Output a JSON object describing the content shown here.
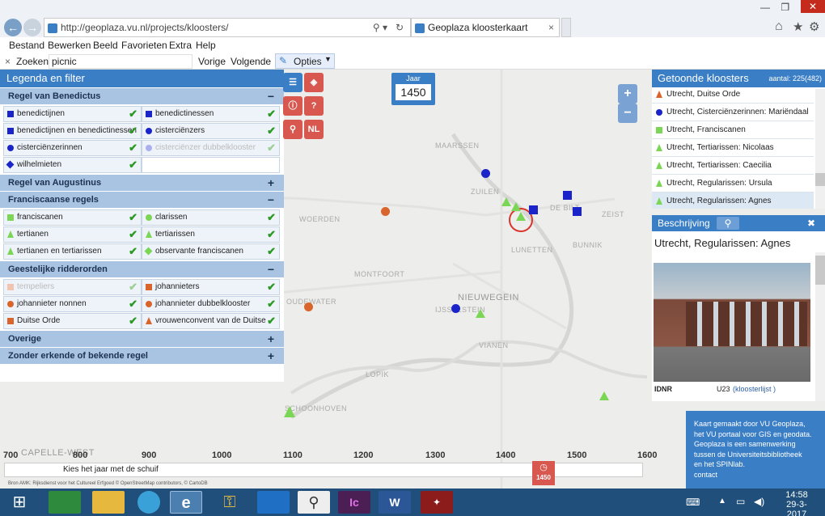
{
  "browser": {
    "url": "http://geoplaza.vu.nl/projects/kloosters/",
    "tab_title": "Geoplaza kloosterkaart",
    "tab_close": "×"
  },
  "menu": [
    "Bestand",
    "Bewerken",
    "Beeld",
    "Favorieten",
    "Extra",
    "Help"
  ],
  "find": {
    "close": "×",
    "label": "Zoeken:",
    "value": "picnic",
    "prev": "Vorige",
    "next": "Volgende",
    "options": "Opties"
  },
  "legend": {
    "title": "Legenda en filter",
    "sections": [
      {
        "title": "Regel van Benedictus",
        "sign": "−",
        "items": [
          {
            "label": "benedictijnen",
            "shape": "sq",
            "color": "#1a24c8",
            "faded": false
          },
          {
            "label": "benedictinessen",
            "shape": "sq",
            "color": "#1a24c8",
            "faded": false
          },
          {
            "label": "benedictijnen en benedictinessen",
            "shape": "sq",
            "color": "#1a24c8",
            "faded": false
          },
          {
            "label": "cisterciënzers",
            "shape": "ci",
            "color": "#1a24c8",
            "faded": false
          },
          {
            "label": "cisterciënzerinnen",
            "shape": "ci",
            "color": "#1a24c8",
            "faded": false
          },
          {
            "label": "cisterciënzer dubbelklooster",
            "shape": "ci",
            "color": "#aab0ee",
            "faded": true
          },
          {
            "label": "wilhelmieten",
            "shape": "di",
            "color": "#1a24c8",
            "faded": false
          }
        ]
      },
      {
        "title": "Regel van Augustinus",
        "sign": "+",
        "items": []
      },
      {
        "title": "Franciscaanse regels",
        "sign": "−",
        "items": [
          {
            "label": "franciscanen",
            "shape": "sq",
            "color": "#7bd655",
            "faded": false
          },
          {
            "label": "clarissen",
            "shape": "ci",
            "color": "#7bd655",
            "faded": false
          },
          {
            "label": "tertianen",
            "shape": "tr",
            "color": "#7bd655",
            "faded": false
          },
          {
            "label": "tertiarissen",
            "shape": "tr",
            "color": "#7bd655",
            "faded": false
          },
          {
            "label": "tertianen en tertiarissen",
            "shape": "tr",
            "color": "#7bd655",
            "faded": false
          },
          {
            "label": "observante franciscanen",
            "shape": "di",
            "color": "#7bd655",
            "faded": false
          }
        ]
      },
      {
        "title": "Geestelijke ridderorden",
        "sign": "−",
        "items": [
          {
            "label": "tempeliers",
            "shape": "sq",
            "color": "#f2c4b0",
            "faded": true
          },
          {
            "label": "johannieters",
            "shape": "sq",
            "color": "#d9642c",
            "faded": false
          },
          {
            "label": "johannieter nonnen",
            "shape": "ci",
            "color": "#d9642c",
            "faded": false
          },
          {
            "label": "johannieter dubbelklooster",
            "shape": "ci",
            "color": "#d9642c",
            "faded": false
          },
          {
            "label": "Duitse Orde",
            "shape": "sq",
            "color": "#d9642c",
            "faded": false
          },
          {
            "label": "vrouwenconvent van de Duitse Orde",
            "shape": "tr",
            "color": "#d9642c",
            "faded": false
          }
        ]
      },
      {
        "title": "Overige",
        "sign": "+",
        "items": []
      },
      {
        "title": "Zonder erkende of bekende regel",
        "sign": "+",
        "items": []
      }
    ]
  },
  "year": {
    "label": "Jaar",
    "value": "1450"
  },
  "map_buttons": {
    "lang": "NL",
    "zoom_in": "+",
    "zoom_out": "−"
  },
  "places": [
    "MAARSSEN",
    "DE BILT",
    "ZEIST",
    "WOERDEN",
    "BUNNIK",
    "MONTFOORT",
    "NIEUWEGEIN",
    "IJSSELSTEIN",
    "OUDEWATER",
    "VIANEN",
    "LOPIK",
    "SCHOONHOVEN",
    "CAPELLE-WEST",
    "ZUILEN",
    "LUNETTEN"
  ],
  "shown": {
    "title": "Getoonde kloosters",
    "count": "aantal: 225(482)",
    "rows": [
      {
        "label": "Utrecht, Duitse Orde",
        "shape": "tr",
        "color": "#d9642c"
      },
      {
        "label": "Utrecht, Cisterciënzerinnen: Mariëndaal",
        "shape": "ci",
        "color": "#1a24c8"
      },
      {
        "label": "Utrecht, Franciscanen",
        "shape": "sq",
        "color": "#7bd655"
      },
      {
        "label": "Utrecht, Tertiarissen: Nicolaas",
        "shape": "tr",
        "color": "#7bd655"
      },
      {
        "label": "Utrecht, Tertiarissen: Caecilia",
        "shape": "tr",
        "color": "#7bd655"
      },
      {
        "label": "Utrecht, Regularissen: Ursula",
        "shape": "tr",
        "color": "#7bd655"
      },
      {
        "label": "Utrecht, Regularissen: Agnes",
        "shape": "tr",
        "color": "#7bd655"
      }
    ]
  },
  "description": {
    "title": "Beschrijving",
    "close": "✖",
    "name": "Utrecht, Regularissen: Agnes",
    "idnr_label": "IDNR",
    "idnr_value": "U23",
    "list_link": "(kloosterlijst )"
  },
  "info": {
    "lines": [
      "Kaart gemaakt door VU Geoplaza,",
      "het VU portaal voor GIS en geodata.",
      "Geoplaza is een samenwerking",
      "tussen de Universiteitsbibliotheek",
      "en het SPINlab.",
      "contact"
    ]
  },
  "axis": [
    "700",
    "800",
    "900",
    "1000",
    "1100",
    "1200",
    "1300",
    "1400",
    "1500",
    "1600"
  ],
  "slider": {
    "label": "Kies het jaar met de schuif",
    "handle_value": "1450"
  },
  "attribution": "Bron AMK: Rijksdienst voor het Cultureel Erfgoed © OpenStreetMap contributors, © CartoDB",
  "clock": {
    "time": "14:58",
    "date": "29-3-2017"
  },
  "icons": [
    "back-icon",
    "forward-icon",
    "search-icon",
    "refresh-icon",
    "home-icon",
    "star-icon",
    "gear-icon",
    "windows-icon",
    "store-icon",
    "folder-icon",
    "globe-icon",
    "ie-icon",
    "key-icon",
    "outlook-icon",
    "magnifier-icon",
    "indesign-icon",
    "word-icon",
    "pdf-icon",
    "keyboard-icon",
    "speaker-icon"
  ]
}
